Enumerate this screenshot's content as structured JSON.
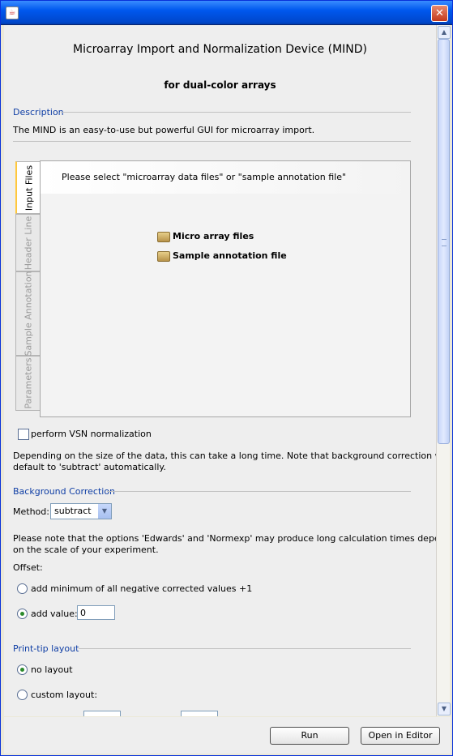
{
  "window": {
    "title": ""
  },
  "header": {
    "title": "Microarray Import and Normalization Device (MIND)",
    "subtitle": "for dual-color arrays"
  },
  "description": {
    "section_label": "Description",
    "text": "The MIND is an easy-to-use but powerful GUI for microarray import."
  },
  "tabs": {
    "items": [
      {
        "label": "Input Files",
        "active": true
      },
      {
        "label": "Header Line",
        "active": false
      },
      {
        "label": "Sample Annotation",
        "active": false
      },
      {
        "label": "Parameters",
        "active": false
      }
    ],
    "instruction": "Please select \"microarray data files\" or \"sample annotation file\"",
    "tree": [
      "Micro array files",
      "Sample annotation file"
    ]
  },
  "vsn": {
    "label": "perform VSN normalization",
    "checked": false,
    "note": [
      "Depending on the size of the data, this can take a long time. Note that background correction will",
      "default to 'subtract' automatically."
    ]
  },
  "background": {
    "section_label": "Background Correction",
    "method_label": "Method:",
    "method_value": "subtract",
    "note": [
      "Please note that the options 'Edwards' and 'Normexp' may produce long calculation times depending",
      "on the scale of your experiment."
    ],
    "offset_label": "Offset:",
    "option_min": "add minimum of all negative corrected values +1",
    "option_add": "add",
    "value_label": "value:",
    "value": "0"
  },
  "printtip": {
    "section_label": "Print-tip layout",
    "option_none": "no layout",
    "option_custom": "custom layout:"
  },
  "footer": {
    "run_label": "Run",
    "editor_label": "Open in Editor"
  }
}
